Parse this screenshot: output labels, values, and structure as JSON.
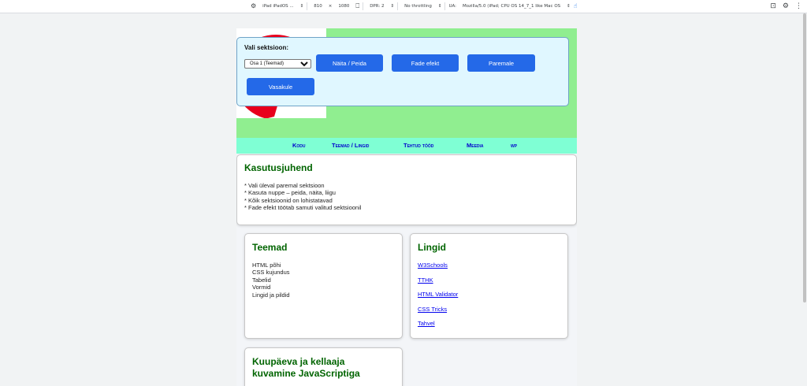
{
  "devtools": {
    "device": "iPad iPadOS ...",
    "width": "810",
    "times": "×",
    "height": "1080",
    "dpr": "DPR: 2",
    "throttle": "No throttling",
    "ua_label": "UA:",
    "ua_value": "Mozilla/5.0 (iPad; CPU OS 14_7_1 like Mac OS"
  },
  "control": {
    "label": "Vali sektsioon:",
    "select_value": "Osa 1 (Teemad)",
    "buttons": {
      "toggle": "Näita / Peida",
      "fade": "Fade efekt",
      "right": "Paremale",
      "left": "Vasakule"
    }
  },
  "nav": [
    "Kodu",
    "Teemad / Lingid",
    "Tehtud tööd",
    "Meedia",
    "wp"
  ],
  "guide": {
    "title": "Kasutusjuhend",
    "lines": [
      "* Vali üleval paremal sektsioon",
      "* Kasuta nuppe – peida, näita, liigu",
      "* Kõik sektsioonid on lohistatavad",
      "* Fade efekt töötab samuti valitud sektsioonil"
    ]
  },
  "teemad": {
    "title": "Teemad",
    "items": [
      "HTML põhi",
      "CSS kujundus",
      "Tabelid",
      "Vormid",
      "Lingid ja pildid"
    ]
  },
  "lingid": {
    "title": "Lingid",
    "items": [
      "W3Schools",
      "TTHK",
      "HTML Validator",
      "CSS Tricks",
      "Tahvel"
    ]
  },
  "kuupaev": {
    "title_line1": "Kuupäeva ja kellaaja",
    "title_line2": "kuvamine JavaScriptiga"
  },
  "colors": {
    "header_green": "#90ee90",
    "nav_aqua": "#7fffd4",
    "button_blue": "#2469e8",
    "heading_green": "#006400",
    "panel_bg": "#e0f7ff"
  }
}
